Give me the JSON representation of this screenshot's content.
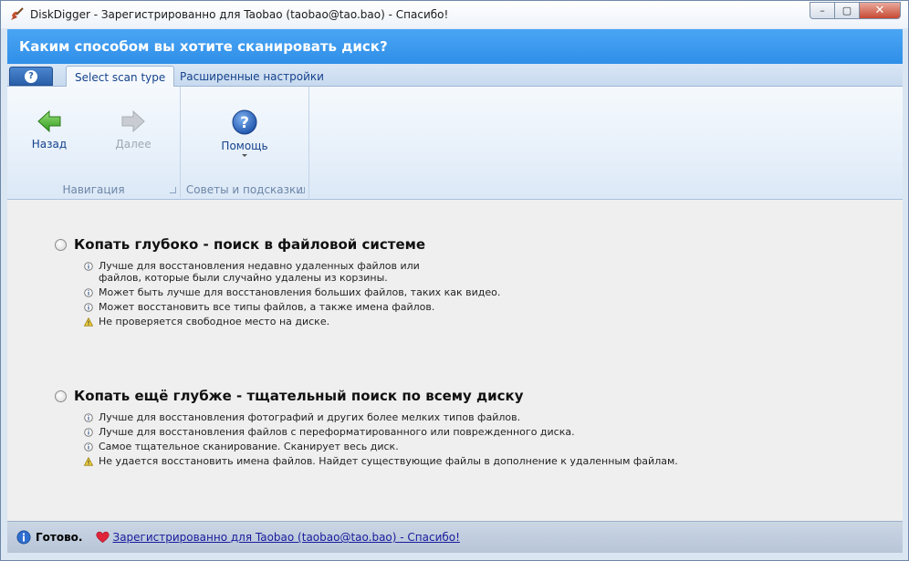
{
  "window": {
    "title": "DiskDigger - Зарегистрированно для Taobao (taobao@tao.bao) - Спасибо!",
    "controls": {
      "minimize": "–",
      "maximize": "▢",
      "close": "✕"
    }
  },
  "header": {
    "title": "Каким способом вы хотите сканировать диск?"
  },
  "ribbon": {
    "app_menu_icon": "question-icon",
    "tabs": [
      {
        "label": "Select scan type",
        "active": true
      },
      {
        "label": "Расширенные настройки",
        "active": false
      }
    ],
    "groups": {
      "navigation": {
        "label": "Навигация",
        "back_label": "Назад",
        "next_label": "Далее"
      },
      "tips": {
        "label": "Советы и подсказки",
        "help_label": "Помощь"
      }
    }
  },
  "options": [
    {
      "title": "Копать глубоко - поиск в файловой системе",
      "bullets": [
        {
          "icon": "info-icon",
          "text": "Лучше для восстановления недавно удаленных файлов или\nфайлов, которые были случайно удалены из корзины."
        },
        {
          "icon": "info-icon",
          "text": "Может быть лучше для восстановления больших файлов, таких как видео."
        },
        {
          "icon": "info-icon",
          "text": "Может восстановить все типы файлов, а также имена файлов."
        },
        {
          "icon": "warning-icon",
          "text": "Не проверяется свободное место на диске."
        }
      ]
    },
    {
      "title": "Копать ещё глубже - тщательный поиск по всему диску",
      "bullets": [
        {
          "icon": "info-icon",
          "text": "Лучше для восстановления фотографий и других более мелких типов файлов."
        },
        {
          "icon": "info-icon",
          "text": "Лучше для восстановления файлов с переформатированного или поврежденного диска."
        },
        {
          "icon": "info-icon",
          "text": "Самое тщательное сканирование. Сканирует весь диск."
        },
        {
          "icon": "warning-icon",
          "text": "Не удается восстановить имена файлов. Найдет существующие файлы в дополнение к удаленным файлам."
        }
      ]
    }
  ],
  "status": {
    "ready": "Готово.",
    "link": "Зарегистрированно для Taobao (taobao@tao.bao) - Спасибо!"
  },
  "colors": {
    "header_blue": "#3a9aee",
    "link": "#1a1a9c",
    "nav_green": "#3fa82c"
  }
}
